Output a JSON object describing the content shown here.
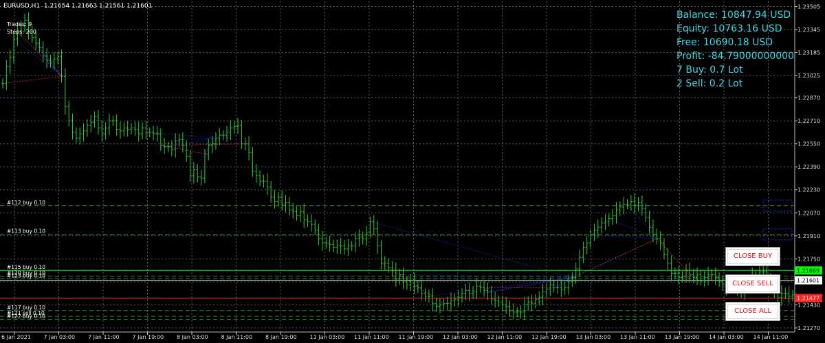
{
  "header": {
    "symbol_tf": "EURUSD,H1",
    "ohlc": "1.21654 1.21663 1.21561 1.21601"
  },
  "stats": {
    "trades": "Trades: 9",
    "steps": "Steps: 200"
  },
  "account": {
    "balance": "Balance: 10847.94 USD",
    "equity": "Equity: 10763.16 USD",
    "free": "Free: 10690.18 USD",
    "profit": "Profit: -84.79000000000",
    "buy": "7 Buy: 0.7 Lot",
    "sell": "2 Sell: 0.2 Lot"
  },
  "buttons": {
    "close_buy": "CLOSE BUY",
    "close_sell": "CLOSE SELL",
    "close_all": "CLOSE ALL"
  },
  "colors": {
    "background": "#000000",
    "grid": "#55606a",
    "candle": "#32cd32",
    "account_text": "#3fd6e6",
    "buy_line": "#2e8b2e",
    "bid_line": "#00ff00",
    "ask_line": "#ff2020",
    "blue_trace": "#2233ee",
    "red_trace": "#cc2222"
  },
  "chart_data": {
    "type": "candlestick",
    "x_ticks": [
      "6 Jan 2021",
      "7 Jan 03:00",
      "7 Jan 11:00",
      "7 Jan 19:00",
      "8 Jan 03:00",
      "8 Jan 11:00",
      "8 Jan 19:00",
      "11 Jan 03:00",
      "11 Jan 11:00",
      "11 Jan 19:00",
      "12 Jan 03:00",
      "12 Jan 11:00",
      "12 Jan 19:00",
      "13 Jan 03:00",
      "13 Jan 11:00",
      "13 Jan 19:00",
      "14 Jan 03:00",
      "14 Jan 11:00"
    ],
    "y_ticks": [
      "1.23505",
      "1.23345",
      "1.23185",
      "1.23025",
      "1.22870",
      "1.22710",
      "1.22550",
      "1.22390",
      "1.22230",
      "1.22070",
      "1.21910",
      "1.21750",
      "1.21590",
      "1.21430",
      "1.21270"
    ],
    "ylim": [
      1.21241,
      1.23541
    ],
    "grid": true,
    "close": [
      1.2297,
      1.2309,
      1.2315,
      1.2328,
      1.2333,
      1.2337,
      1.2341,
      1.2333,
      1.2329,
      1.2325,
      1.2322,
      1.2316,
      1.2313,
      1.2312,
      1.2314,
      1.2316,
      1.2302,
      1.2281,
      1.2271,
      1.2263,
      1.2259,
      1.2262,
      1.2264,
      1.2268,
      1.227,
      1.2274,
      1.2266,
      1.2262,
      1.2266,
      1.2271,
      1.2271,
      1.2265,
      1.2264,
      1.2266,
      1.2265,
      1.2266,
      1.2265,
      1.2262,
      1.2266,
      1.2263,
      1.2263,
      1.2262,
      1.2262,
      1.2254,
      1.2253,
      1.2253,
      1.2251,
      1.2257,
      1.2258,
      1.2254,
      1.2246,
      1.2233,
      1.2237,
      1.2232,
      1.2231,
      1.2248,
      1.2254,
      1.2255,
      1.2259,
      1.2261,
      1.2261,
      1.2263,
      1.2266,
      1.2267,
      1.2268,
      1.2255,
      1.2255,
      1.2249,
      1.2236,
      1.2233,
      1.2229,
      1.2229,
      1.2225,
      1.2218,
      1.2215,
      1.2218,
      1.2213,
      1.2214,
      1.2209,
      1.2208,
      1.2205,
      1.2208,
      1.2202,
      1.2201,
      1.2199,
      1.2195,
      1.2189,
      1.2186,
      1.2186,
      1.2185,
      1.2183,
      1.2184,
      1.2184,
      1.2182,
      1.2184,
      1.2184,
      1.2189,
      1.219,
      1.2189,
      1.2193,
      1.2201,
      1.2196,
      1.2184,
      1.2172,
      1.2172,
      1.2169,
      1.2167,
      1.2161,
      1.2164,
      1.2159,
      1.2157,
      1.216,
      1.2156,
      1.2155,
      1.2151,
      1.2149,
      1.2149,
      1.2144,
      1.2142,
      1.2143,
      1.2144,
      1.2144,
      1.2146,
      1.2147,
      1.2148,
      1.2151,
      1.2153,
      1.2151,
      1.2152,
      1.2156,
      1.2155,
      1.2153,
      1.2152,
      1.2147,
      1.2146,
      1.2145,
      1.2143,
      1.2142,
      1.2139,
      1.2138,
      1.2138,
      1.2138,
      1.2143,
      1.2145,
      1.2144,
      1.2147,
      1.2148,
      1.2152,
      1.2154,
      1.2157,
      1.2155,
      1.2155,
      1.2154,
      1.2155,
      1.2159,
      1.2162,
      1.2168,
      1.2176,
      1.2183,
      1.2186,
      1.2192,
      1.2195,
      1.2197,
      1.22,
      1.2201,
      1.2203,
      1.2205,
      1.2209,
      1.2211,
      1.2213,
      1.2213,
      1.2215,
      1.2212,
      1.2214,
      1.221,
      1.2204,
      1.2197,
      1.2192,
      1.2189,
      1.2186,
      1.2178,
      1.2172,
      1.2165,
      1.2165,
      1.2162,
      1.2163,
      1.2167,
      1.2164,
      1.2162,
      1.2164,
      1.216,
      1.2162,
      1.2164,
      1.2164,
      1.2162,
      1.2159,
      1.2157,
      1.2155,
      1.2156,
      1.2156,
      1.2153,
      1.2152,
      1.2156,
      1.216,
      1.2164,
      1.2164,
      1.2166,
      1.2166,
      1.216,
      1.2157,
      1.2151,
      1.2148,
      1.2151,
      1.2151,
      1.2149,
      1.215
    ],
    "levels": [
      {
        "label": "#112 buy 0.10",
        "price": 1.2212,
        "box": "1.2212"
      },
      {
        "label": "#113 buy 0.10",
        "price": 1.2192,
        "box": "1.2192"
      },
      {
        "label": "#115 buy 0.10",
        "price": 1.2167,
        "box": ""
      },
      {
        "label": "#120 buy 0.10",
        "price": 1.2163,
        "box": ""
      },
      {
        "label": "#123 buy 0.10",
        "price": 1.2161,
        "box": ""
      },
      {
        "label": "#117 buy 0.10",
        "price": 1.2139,
        "box": ""
      },
      {
        "label": "#121 sell 0.10",
        "price": 1.2135,
        "box": ""
      },
      {
        "label": "#122 buy 0.10",
        "price": 1.2133,
        "box": ""
      }
    ],
    "bid": {
      "price": 1.21669,
      "label": "1.21669"
    },
    "current": {
      "price": 1.21601,
      "label": "1.21601"
    },
    "ask": {
      "price": 1.21477,
      "label": "1.21477"
    }
  }
}
